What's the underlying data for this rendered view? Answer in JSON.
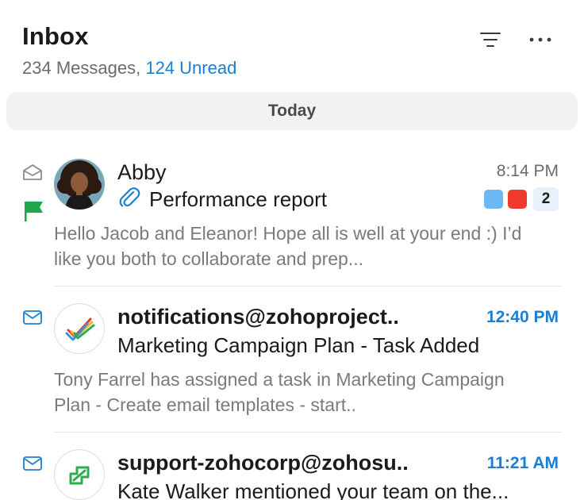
{
  "header": {
    "title": "Inbox",
    "message_count": "234 Messages,",
    "unread_count": "124 Unread",
    "filter_icon": "filter-icon",
    "more_icon": "more-horizontal-icon"
  },
  "day_group": "Today",
  "messages": [
    {
      "sender": "Abby",
      "time": "8:14 PM",
      "subject": "Performance report",
      "preview": "Hello Jacob and Eleanor! Hope all is well at your end :) I’d like you both to collaborate and prep...",
      "read": true,
      "flagged": true,
      "has_attachment": true,
      "tags": [
        "#6bb8f5",
        "#f03a2e"
      ],
      "thread_count": "2"
    },
    {
      "sender": "notifications@zohoproject..",
      "time": "12:40 PM",
      "subject": "Marketing Campaign Plan - Task Added",
      "preview": "Tony Farrel has assigned a task in Marketing Campaign Plan - Create email templates - start..",
      "read": false
    },
    {
      "sender": "support-zohocorp@zohosu..",
      "time": "11:21 AM",
      "subject": "Kate Walker mentioned your team on the...",
      "read": false
    }
  ],
  "colors": {
    "accent": "#1a7fd4",
    "flag": "#1fa84a"
  }
}
